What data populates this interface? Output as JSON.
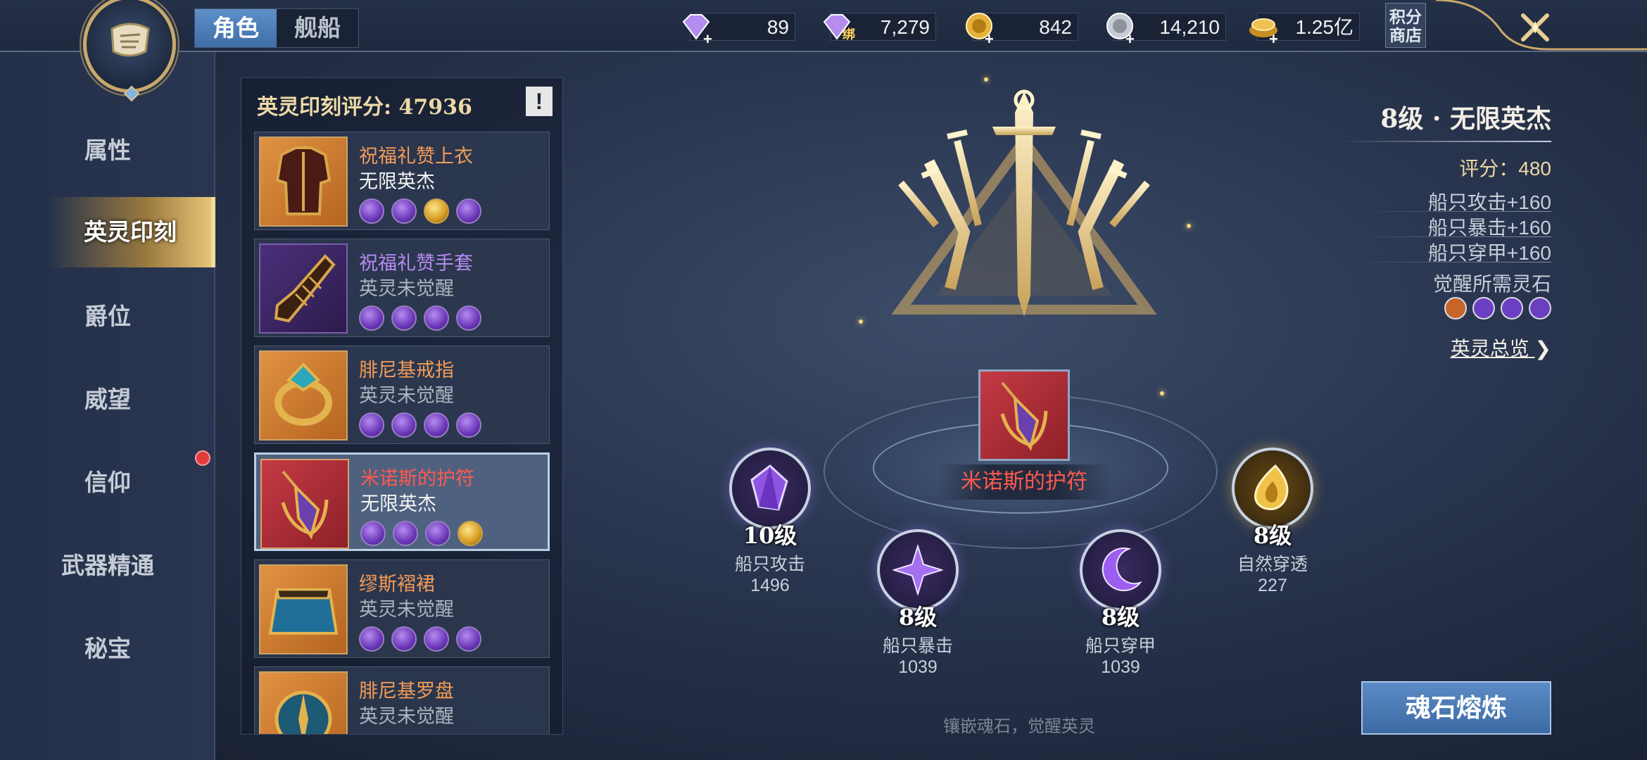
{
  "tabs": [
    "角色",
    "舰船"
  ],
  "currencies": [
    {
      "icon": "diamond-icon",
      "value": "89"
    },
    {
      "icon": "bound-diamond-icon",
      "badge": "绑",
      "value": "7,279"
    },
    {
      "icon": "gold-coin-icon",
      "value": "842"
    },
    {
      "icon": "silver-coin-icon",
      "value": "14,210"
    },
    {
      "icon": "gold-pile-icon",
      "value": "1.25亿"
    }
  ],
  "shop_label": "积分商店",
  "nav": [
    "属性",
    "英灵印刻",
    "爵位",
    "威望",
    "信仰",
    "武器精通",
    "秘宝"
  ],
  "list": {
    "score_label": "英灵印刻评分",
    "score_value": "47936",
    "info_mark": "!",
    "items": [
      {
        "name": "祝福礼赞上衣",
        "status": "无限英杰",
        "rarity": "orange"
      },
      {
        "name": "祝福礼赞手套",
        "status": "英灵未觉醒",
        "rarity": "purple"
      },
      {
        "name": "腓尼基戒指",
        "status": "英灵未觉醒",
        "rarity": "orange"
      },
      {
        "name": "米诺斯的护符",
        "status": "无限英杰",
        "rarity": "red"
      },
      {
        "name": "缪斯褶裙",
        "status": "英灵未觉醒",
        "rarity": "orange"
      },
      {
        "name": "腓尼基罗盘",
        "status": "英灵未觉醒",
        "rarity": "orange"
      }
    ]
  },
  "center": {
    "item_name": "米诺斯的护符",
    "slots": [
      {
        "level": "10级",
        "name": "船只攻击",
        "value": "1496",
        "icon": "purple-crystal-icon"
      },
      {
        "level": "8级",
        "name": "船只暴击",
        "value": "1039",
        "icon": "purple-star-icon"
      },
      {
        "level": "8级",
        "name": "船只穿甲",
        "value": "1039",
        "icon": "purple-moon-icon"
      },
      {
        "level": "8级",
        "name": "自然穿透",
        "value": "227",
        "icon": "gold-flame-icon"
      }
    ],
    "hint": "镶嵌魂石，觉醒英灵"
  },
  "right": {
    "title": "8级 · 无限英杰",
    "score_label": "评分：",
    "score_value": "480",
    "stats": [
      "船只攻击+160",
      "船只暴击+160",
      "船只穿甲+160"
    ],
    "need_label": "觉醒所需灵石",
    "stones": [
      "orange",
      "purple",
      "purple",
      "purple"
    ],
    "overview_link": "英灵总览",
    "smelt_button": "魂石熔炼"
  },
  "colors": {
    "accent_gold": "#ecd9a6",
    "rarity_orange": "#f29b58",
    "rarity_purple": "#b68af0",
    "rarity_red": "#ff5a4e",
    "button_blue": "#4a7bb8"
  }
}
